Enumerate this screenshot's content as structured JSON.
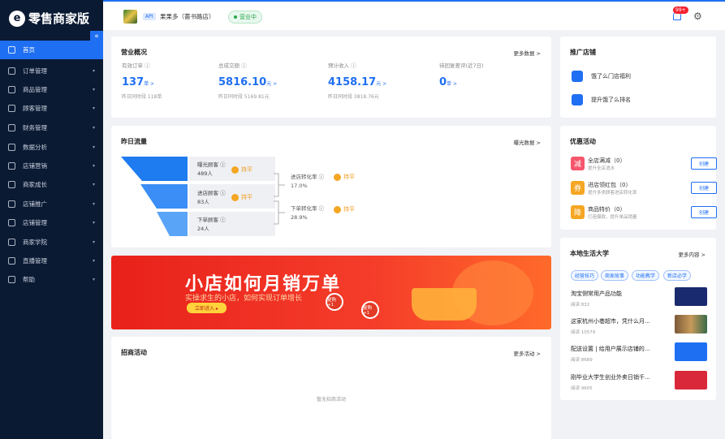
{
  "brand": {
    "logo": "e",
    "name": "零售商家版"
  },
  "sidebar": {
    "items": [
      {
        "label": "首页",
        "icon": "home-icon"
      },
      {
        "label": "订单管理",
        "icon": "order-icon"
      },
      {
        "label": "商品管理",
        "icon": "goods-icon"
      },
      {
        "label": "顾客管理",
        "icon": "customer-icon"
      },
      {
        "label": "财务管理",
        "icon": "finance-icon"
      },
      {
        "label": "数据分析",
        "icon": "data-icon"
      },
      {
        "label": "店铺营销",
        "icon": "marketing-icon"
      },
      {
        "label": "商家成长",
        "icon": "growth-icon"
      },
      {
        "label": "店铺推广",
        "icon": "promote-icon"
      },
      {
        "label": "店铺管理",
        "icon": "store-icon"
      },
      {
        "label": "商家学院",
        "icon": "academy-icon"
      },
      {
        "label": "直播管理",
        "icon": "live-icon"
      },
      {
        "label": "帮助",
        "icon": "help-icon"
      }
    ],
    "collapse": "«"
  },
  "topbar": {
    "api": "API",
    "shop": "果果多（蔷书路店）",
    "status": "营业中",
    "badge": "99+"
  },
  "overview": {
    "title": "营业概况",
    "more": "更多数据 >",
    "metrics": [
      {
        "label": "有效订单 ⓘ",
        "value": "137",
        "unit": "单 >",
        "compare": "昨日同时段 118单"
      },
      {
        "label": "总成交额 ⓘ",
        "value": "5816.10",
        "unit": "元 >",
        "compare": "昨日同时段 5169.81元"
      },
      {
        "label": "预计收入 ⓘ",
        "value": "4158.17",
        "unit": "元 >",
        "compare": "昨日同时段 3818.76元"
      },
      {
        "label": "待回复差评(近7日)",
        "value": "0",
        "unit": "单 >",
        "compare": ""
      }
    ]
  },
  "traffic": {
    "title": "昨日流量",
    "more": "曝光数据 >",
    "steps": [
      {
        "label": "曝光顾客 ⓘ",
        "value": "489人"
      },
      {
        "label": "进店顾客 ⓘ",
        "value": "83人"
      },
      {
        "label": "下单顾客 ⓘ",
        "value": "24人"
      }
    ],
    "flat": "持平",
    "conversions": [
      {
        "label": "进店转化率 ⓘ",
        "value": "17.0%"
      },
      {
        "label": "下单转化率 ⓘ",
        "value": "28.9%"
      }
    ]
  },
  "banner": {
    "title": "小店如何月销万单",
    "subtitle": "实操求生的小店，如何实现订单增长",
    "button": "立即进入 ▸",
    "coin1": "复购\n+1",
    "coin2": "复购\n+1"
  },
  "recruit": {
    "title": "招商活动",
    "more": "更多活动 >",
    "empty": "暂无招商活动"
  },
  "promote": {
    "title": "推广店铺",
    "items": [
      {
        "label": "饿了么门店福利"
      },
      {
        "label": "提升饿了么排名"
      }
    ]
  },
  "coupons": {
    "title": "优惠活动",
    "button": "创建",
    "items": [
      {
        "icon": "减",
        "color": "#f5566c",
        "title": "全店满减（0）",
        "sub": "提升全店消水"
      },
      {
        "icon": "券",
        "color": "#f5a623",
        "title": "进店领红包（0）",
        "sub": "提升多类顾客进店转化率"
      },
      {
        "icon": "降",
        "color": "#f5a623",
        "title": "商品特价（0）",
        "sub": "打造爆款，提升单品销量"
      }
    ]
  },
  "college": {
    "title": "本地生活大学",
    "more": "更多内容 >",
    "tags": [
      "经营技巧",
      "商家故事",
      "功能教学",
      "新店必学"
    ],
    "articles": [
      {
        "title": "淘宝侧常用产品功能",
        "reads": "阅读 832",
        "thumb": "#1a2a6e"
      },
      {
        "title": "这家杭州小巷超市，凭什么月...",
        "reads": "阅读 10579",
        "thumb": "#7a5a3a"
      },
      {
        "title": "配送设置 | 给用户展示店铺的...",
        "reads": "阅读 8689",
        "thumb": "#1f6ff2"
      },
      {
        "title": "刚毕业大学生创业外卖日销千...",
        "reads": "阅读 9605",
        "thumb": "#d9283a"
      }
    ]
  }
}
